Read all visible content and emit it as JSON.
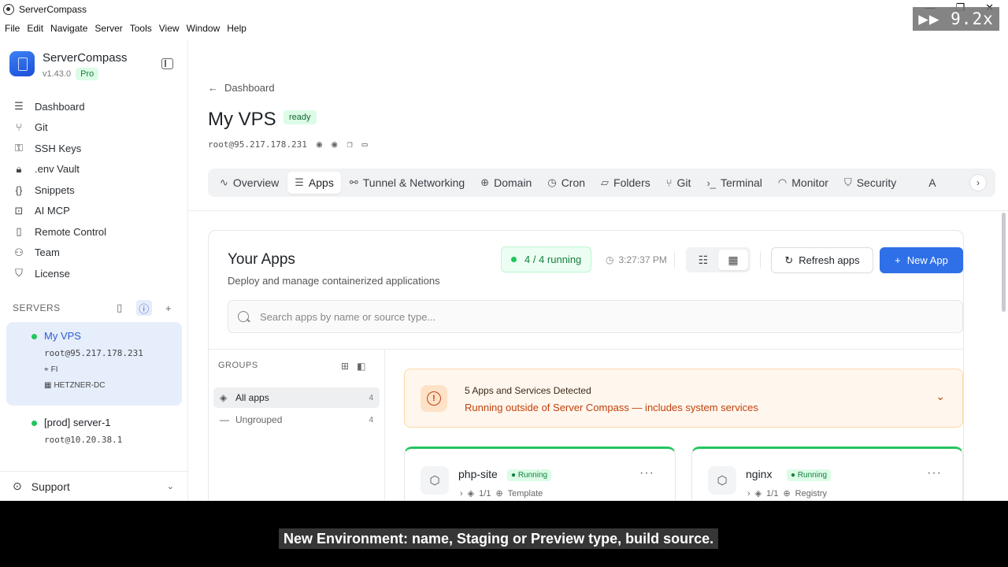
{
  "window": {
    "title": "ServerCompass",
    "controls": [
      "—",
      "❐",
      "✕"
    ],
    "speed_overlay": "▶▶ 9.2x"
  },
  "menu": [
    "File",
    "Edit",
    "Navigate",
    "Server",
    "Tools",
    "View",
    "Window",
    "Help"
  ],
  "sidebar": {
    "brand_name": "ServerCompass",
    "version": "v1.43.0",
    "plan_badge": "Pro",
    "nav": [
      {
        "label": "Dashboard",
        "icon": "dashboard-icon"
      },
      {
        "label": "Git",
        "icon": "git-icon"
      },
      {
        "label": "SSH Keys",
        "icon": "key-icon"
      },
      {
        "label": ".env Vault",
        "icon": "lock-icon"
      },
      {
        "label": "Snippets",
        "icon": "braces-icon"
      },
      {
        "label": "AI MCP",
        "icon": "robot-icon"
      },
      {
        "label": "Remote Control",
        "icon": "phone-icon"
      },
      {
        "label": "Team",
        "icon": "user-icon"
      },
      {
        "label": "License",
        "icon": "shield-icon"
      }
    ],
    "servers_heading": "SERVERS",
    "servers": [
      {
        "name": "My VPS",
        "addr": "root@95.217.178.231",
        "location": "FI",
        "provider": "HETZNER-DC",
        "status": "online"
      },
      {
        "name": "[prod] server-1",
        "addr": "root@10.20.38.1",
        "status": "online"
      }
    ],
    "support_label": "Support"
  },
  "main": {
    "breadcrumb": "Dashboard",
    "title": "My VPS",
    "status_badge": "ready",
    "host": "root@95.217.178.231",
    "tabs": [
      {
        "label": "Overview",
        "icon": "pulse-icon"
      },
      {
        "label": "Apps",
        "icon": "server-stack-icon",
        "active": true
      },
      {
        "label": "Tunnel & Networking",
        "icon": "network-icon"
      },
      {
        "label": "Domain",
        "icon": "globe-icon"
      },
      {
        "label": "Cron",
        "icon": "clock-icon"
      },
      {
        "label": "Folders",
        "icon": "folder-icon"
      },
      {
        "label": "Git",
        "icon": "git-icon"
      },
      {
        "label": "Terminal",
        "icon": "terminal-icon"
      },
      {
        "label": "Monitor",
        "icon": "gauge-icon"
      },
      {
        "label": "Security",
        "icon": "shield-icon"
      }
    ],
    "tabs_overflow": "A"
  },
  "apps": {
    "title": "Your Apps",
    "subtitle": "Deploy and manage containerized applications",
    "running": "4 / 4 running",
    "timestamp": "3:27:37 PM",
    "refresh_label": "Refresh apps",
    "new_app_label": "New App",
    "search_placeholder": "Search apps by name or source type...",
    "groups_heading": "GROUPS",
    "groups": [
      {
        "label": "All apps",
        "count": "4",
        "active": true
      },
      {
        "label": "Ungrouped",
        "count": "4"
      }
    ],
    "alert": {
      "title": "5 Apps and Services Detected",
      "description": "Running outside of Server Compass — includes system services"
    },
    "cards": [
      {
        "name": "php-site",
        "status": "Running",
        "replicas": "1/1",
        "source": "Template"
      },
      {
        "name": "nginx",
        "status": "Running",
        "replicas": "1/1",
        "source": "Registry"
      }
    ]
  },
  "caption": "New Environment: name, Staging or Preview type, build source.",
  "colors": {
    "accent": "#2f6fe8",
    "running_green": "#22c55e",
    "warning_orange": "#c2410c"
  }
}
